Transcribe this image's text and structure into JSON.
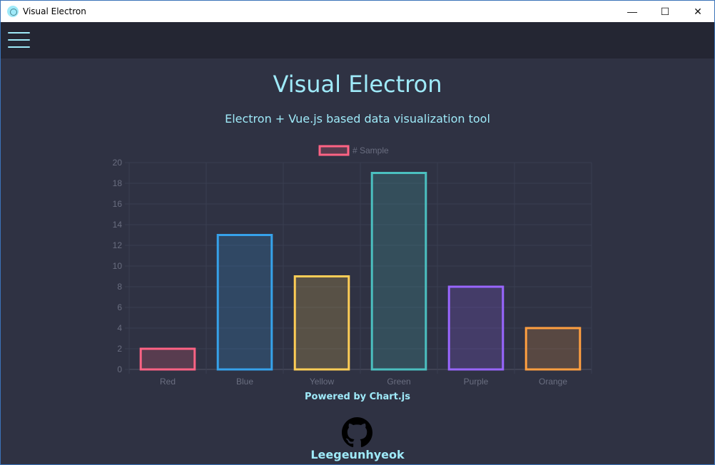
{
  "window": {
    "title": "Visual Electron",
    "icon": "electron-icon",
    "controls": {
      "minimize": "—",
      "maximize": "☐",
      "close": "✕"
    }
  },
  "topbar": {
    "menu_icon": "hamburger-menu-icon"
  },
  "main": {
    "title": "Visual Electron",
    "subtitle": "Electron + Vue.js based data visualization tool",
    "powered_by": "Powered by Chart.js",
    "github_icon": "github-icon",
    "author": "Leegeunhyeok"
  },
  "colors": {
    "accent": "#9feaf9",
    "background": "#2f3243",
    "topbar": "#242633"
  },
  "chart_data": {
    "type": "bar",
    "legend": {
      "label": "# Sample",
      "position": "top"
    },
    "categories": [
      "Red",
      "Blue",
      "Yellow",
      "Green",
      "Purple",
      "Orange"
    ],
    "values": [
      2,
      13,
      9,
      19,
      8,
      4
    ],
    "border_colors": [
      "#ff6384",
      "#36a2eb",
      "#ffce56",
      "#4bc0c0",
      "#9966ff",
      "#ff9f40"
    ],
    "fill_colors": [
      "rgba(255,99,132,0.2)",
      "rgba(54,162,235,0.2)",
      "rgba(255,206,86,0.2)",
      "rgba(75,192,192,0.2)",
      "rgba(153,102,255,0.2)",
      "rgba(255,159,64,0.2)"
    ],
    "yticks": [
      "0",
      "2",
      "4",
      "6",
      "8",
      "10",
      "12",
      "14",
      "16",
      "18",
      "20"
    ],
    "ylim": [
      0,
      20
    ],
    "grid": true
  }
}
